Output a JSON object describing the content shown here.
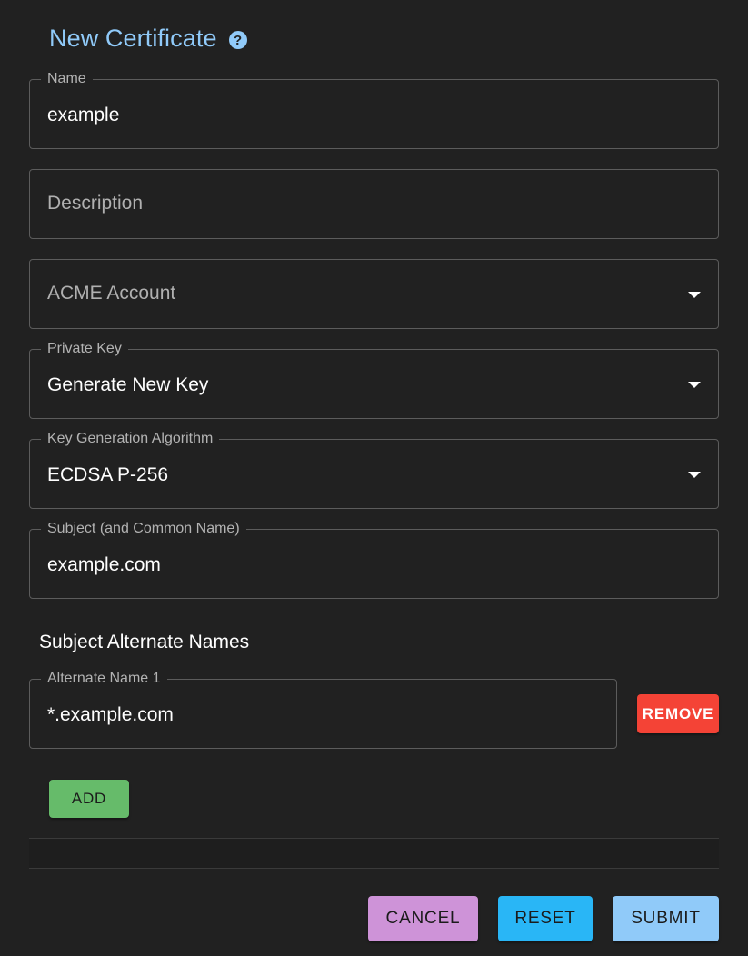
{
  "header": {
    "title": "New Certificate",
    "help_icon": "question-circle-icon",
    "help_glyph": "?"
  },
  "fields": {
    "name": {
      "label": "Name",
      "value": "example"
    },
    "description": {
      "placeholder": "Description"
    },
    "acme_account": {
      "placeholder": "ACME Account"
    },
    "private_key": {
      "label": "Private Key",
      "value": "Generate New Key"
    },
    "key_algorithm": {
      "label": "Key Generation Algorithm",
      "value": "ECDSA P-256"
    },
    "subject": {
      "label": "Subject (and Common Name)",
      "value": "example.com"
    }
  },
  "alt_names": {
    "heading": "Subject Alternate Names",
    "items": [
      {
        "label": "Alternate Name 1",
        "value": "*.example.com",
        "remove_label": "REMOVE"
      }
    ],
    "add_label": "ADD"
  },
  "actions": {
    "cancel_label": "CANCEL",
    "reset_label": "RESET",
    "submit_label": "SUBMIT"
  },
  "colors": {
    "background": "#212121",
    "title": "#90caf9",
    "remove": "#f44336",
    "add": "#66bb6a",
    "cancel": "#ce93d8",
    "reset": "#29b6f6",
    "submit": "#90caf9"
  }
}
